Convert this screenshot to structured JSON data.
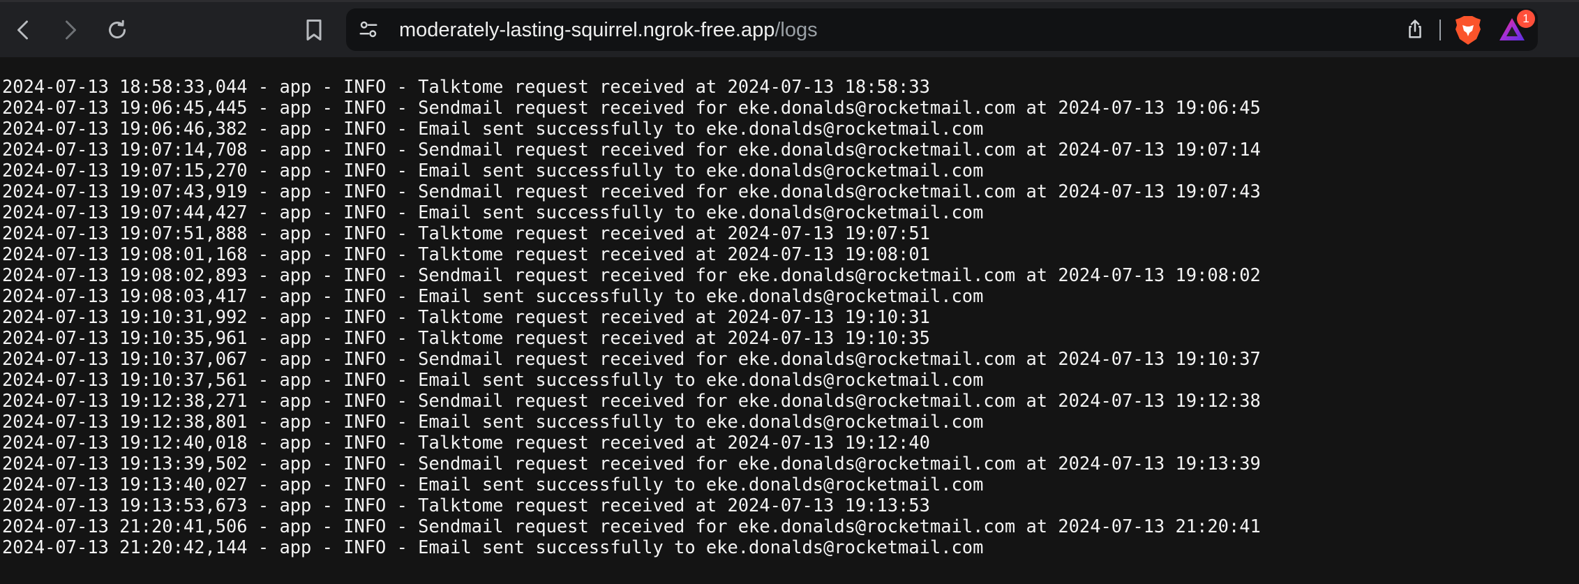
{
  "browser": {
    "url_host": "moderately-lasting-squirrel.ngrok-free.app",
    "url_path": "/logs",
    "notification_count": "1"
  },
  "icons": {
    "back": "arrow-left-icon",
    "forward": "arrow-right-icon",
    "reload": "reload-icon",
    "bookmark": "bookmark-icon",
    "site_settings": "sliders-icon",
    "share": "share-icon",
    "brave": "brave-lion-icon",
    "rewards": "brave-rewards-triangle-icon"
  },
  "logs": [
    "2024-07-13 18:58:33,044 - app - INFO - Talktome request received at 2024-07-13 18:58:33",
    "2024-07-13 19:06:45,445 - app - INFO - Sendmail request received for eke.donalds@rocketmail.com at 2024-07-13 19:06:45",
    "2024-07-13 19:06:46,382 - app - INFO - Email sent successfully to eke.donalds@rocketmail.com",
    "2024-07-13 19:07:14,708 - app - INFO - Sendmail request received for eke.donalds@rocketmail.com at 2024-07-13 19:07:14",
    "2024-07-13 19:07:15,270 - app - INFO - Email sent successfully to eke.donalds@rocketmail.com",
    "2024-07-13 19:07:43,919 - app - INFO - Sendmail request received for eke.donalds@rocketmail.com at 2024-07-13 19:07:43",
    "2024-07-13 19:07:44,427 - app - INFO - Email sent successfully to eke.donalds@rocketmail.com",
    "2024-07-13 19:07:51,888 - app - INFO - Talktome request received at 2024-07-13 19:07:51",
    "2024-07-13 19:08:01,168 - app - INFO - Talktome request received at 2024-07-13 19:08:01",
    "2024-07-13 19:08:02,893 - app - INFO - Sendmail request received for eke.donalds@rocketmail.com at 2024-07-13 19:08:02",
    "2024-07-13 19:08:03,417 - app - INFO - Email sent successfully to eke.donalds@rocketmail.com",
    "2024-07-13 19:10:31,992 - app - INFO - Talktome request received at 2024-07-13 19:10:31",
    "2024-07-13 19:10:35,961 - app - INFO - Talktome request received at 2024-07-13 19:10:35",
    "2024-07-13 19:10:37,067 - app - INFO - Sendmail request received for eke.donalds@rocketmail.com at 2024-07-13 19:10:37",
    "2024-07-13 19:10:37,561 - app - INFO - Email sent successfully to eke.donalds@rocketmail.com",
    "2024-07-13 19:12:38,271 - app - INFO - Sendmail request received for eke.donalds@rocketmail.com at 2024-07-13 19:12:38",
    "2024-07-13 19:12:38,801 - app - INFO - Email sent successfully to eke.donalds@rocketmail.com",
    "2024-07-13 19:12:40,018 - app - INFO - Talktome request received at 2024-07-13 19:12:40",
    "2024-07-13 19:13:39,502 - app - INFO - Sendmail request received for eke.donalds@rocketmail.com at 2024-07-13 19:13:39",
    "2024-07-13 19:13:40,027 - app - INFO - Email sent successfully to eke.donalds@rocketmail.com",
    "2024-07-13 19:13:53,673 - app - INFO - Talktome request received at 2024-07-13 19:13:53",
    "2024-07-13 21:20:41,506 - app - INFO - Sendmail request received for eke.donalds@rocketmail.com at 2024-07-13 21:20:41",
    "2024-07-13 21:20:42,144 - app - INFO - Email sent successfully to eke.donalds@rocketmail.com"
  ]
}
